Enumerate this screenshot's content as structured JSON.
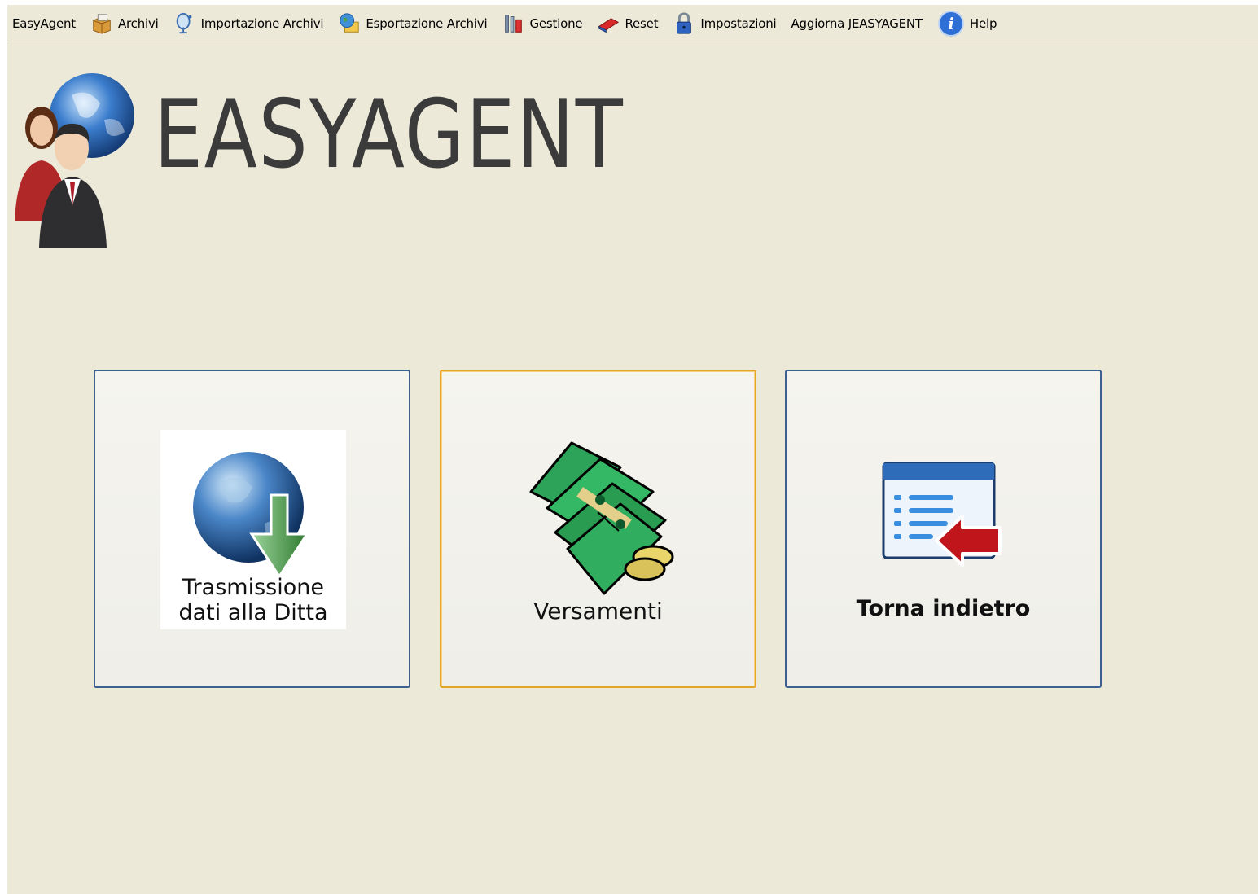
{
  "menubar": {
    "items": [
      {
        "label": "EasyAgent",
        "icon": "none"
      },
      {
        "label": "Archivi",
        "icon": "archive-box-icon"
      },
      {
        "label": "Importazione Archivi",
        "icon": "import-satellite-icon"
      },
      {
        "label": "Esportazione Archivi",
        "icon": "export-globe-icon"
      },
      {
        "label": "Gestione",
        "icon": "tools-icon"
      },
      {
        "label": "Reset",
        "icon": "eraser-icon"
      },
      {
        "label": "Impostazioni",
        "icon": "lock-icon"
      },
      {
        "label": "Aggiorna JEASYAGENT",
        "icon": "none"
      },
      {
        "label": "Help",
        "icon": "info-icon"
      }
    ]
  },
  "logo": {
    "text": "EASYAGENT"
  },
  "tiles": [
    {
      "line1": "Trasmissione",
      "line2": "dati alla Ditta",
      "icon": "globe-download-icon"
    },
    {
      "label": "Versamenti",
      "icon": "money-stack-icon"
    },
    {
      "label": "Torna indietro",
      "icon": "back-list-icon"
    }
  ],
  "colors": {
    "background": "#ece9d8",
    "tile_border": "#3c6190",
    "focus_border": "#e6a528"
  }
}
